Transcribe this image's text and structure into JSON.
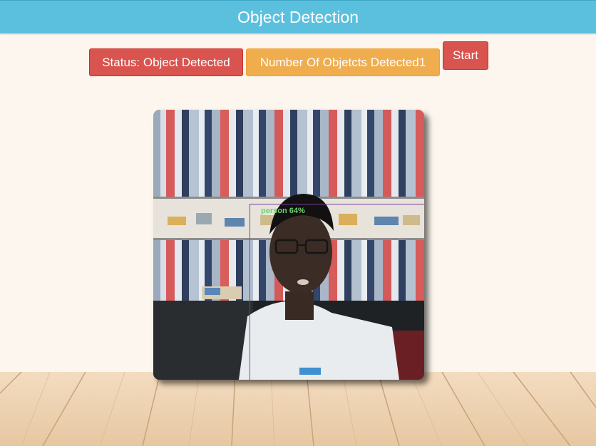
{
  "header": {
    "title": "Object Detection"
  },
  "controls": {
    "status_label": "Status: Object Detected",
    "count_label": "Number Of Objetcts Detected1",
    "start_label": "Start"
  },
  "detection": {
    "label": "person 64%"
  },
  "colors": {
    "header_bg": "#5bc0de",
    "danger": "#d9534f",
    "warning": "#f0ad4e",
    "page_bg": "#fdf6ee",
    "box": "#7a3fa0",
    "label": "#6fd16f"
  }
}
